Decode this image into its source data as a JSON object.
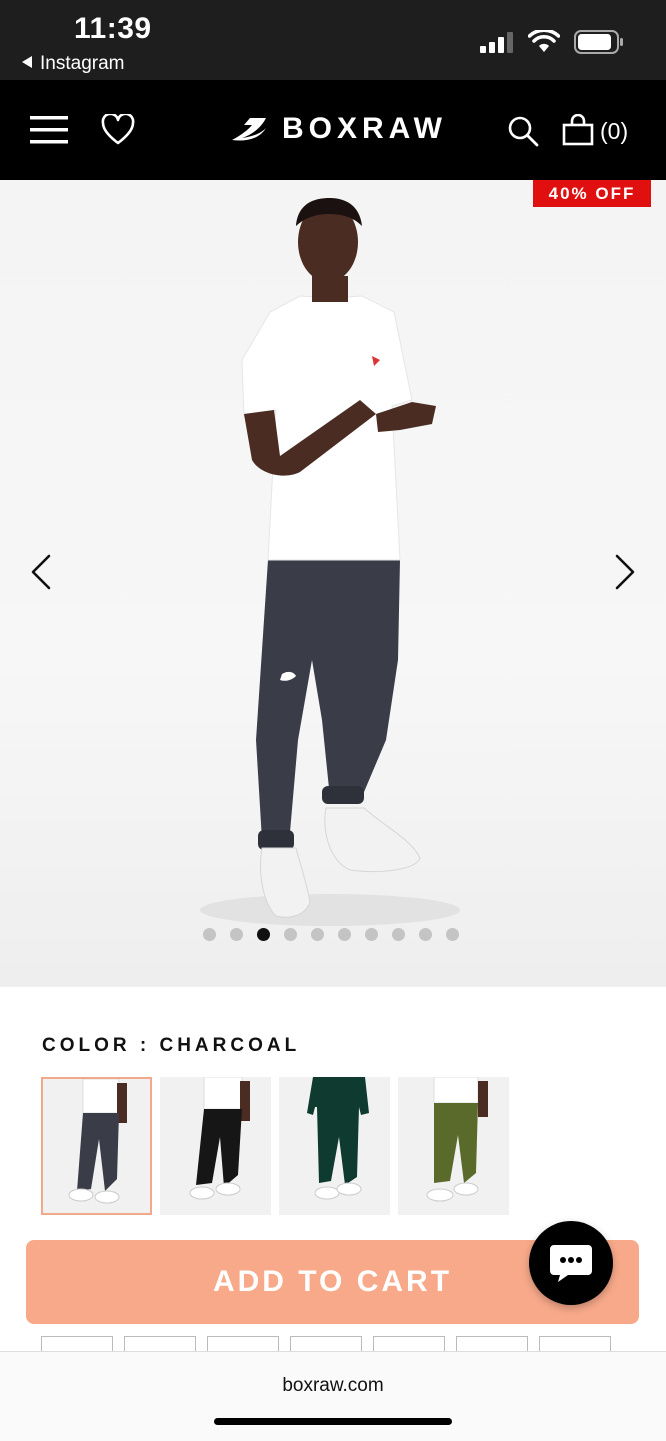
{
  "status_bar": {
    "time": "11:39",
    "back_app": "Instagram"
  },
  "nav": {
    "brand": "BOXRAW",
    "cart_count": "(0)",
    "icons": [
      "menu-icon",
      "heart-icon",
      "search-icon",
      "bag-icon"
    ]
  },
  "product": {
    "badge": "40% OFF",
    "gallery": {
      "total_images": 10,
      "active_index": 2
    }
  },
  "color": {
    "label": "COLOR : CHARCOAL",
    "swatches": [
      {
        "name": "charcoal",
        "selected": true,
        "pants": "#3a3d48"
      },
      {
        "name": "black",
        "selected": false,
        "pants": "#161616"
      },
      {
        "name": "green",
        "selected": false,
        "pants": "#0f3a30"
      },
      {
        "name": "olive",
        "selected": false,
        "pants": "#5a6a2a"
      }
    ]
  },
  "actions": {
    "add_to_cart": "ADD TO CART"
  },
  "browser": {
    "url": "boxraw.com"
  },
  "colors": {
    "accent": "#f8a98a",
    "badge": "#e01010",
    "nav_bg": "#000000"
  }
}
